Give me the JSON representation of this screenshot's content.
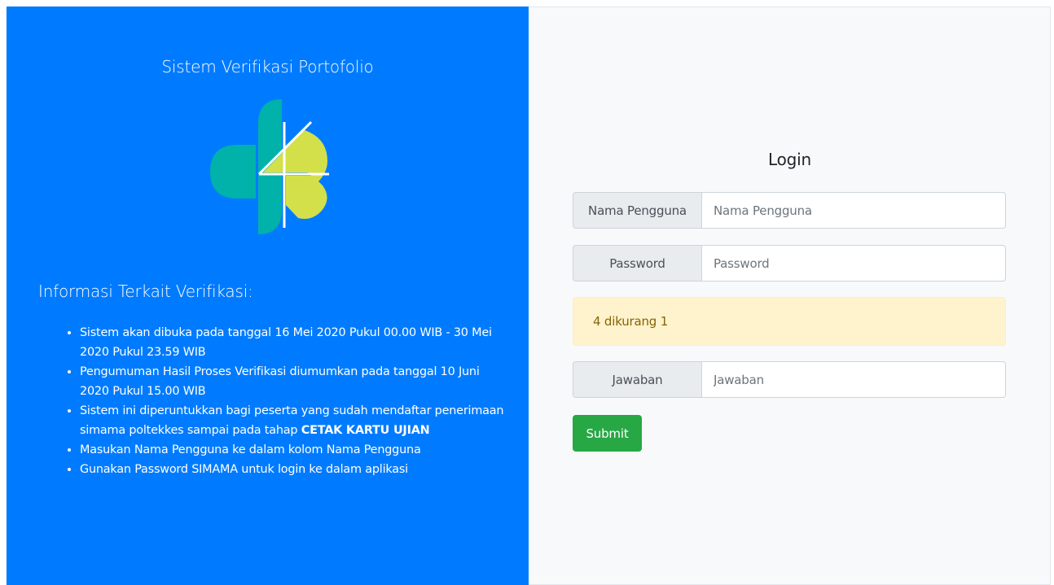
{
  "left": {
    "system_title": "Sistem Verifikasi Portofolio",
    "info_heading": "Informasi Terkait Verifikasi:",
    "info_items": [
      "Sistem akan dibuka pada tanggal 16 Mei 2020 Pukul 00.00 WIB - 30 Mei 2020 Pukul 23.59 WIB",
      "Pengumuman Hasil Proses Verifikasi diumumkan pada tanggal 10 Juni 2020 Pukul 15.00 WIB",
      "Sistem ini diperuntukkan bagi peserta yang sudah mendaftar penerimaan simama poltekkes sampai pada tahap ",
      "Masukan Nama Pengguna ke dalam kolom Nama Pengguna",
      "Gunakan Password SIMAMA untuk login ke dalam aplikasi"
    ],
    "info_item_bold": "CETAK KARTU UJIAN",
    "logo_colors": {
      "teal": "#00b2a9",
      "lime": "#d4e04a"
    }
  },
  "login": {
    "title": "Login",
    "username": {
      "label": "Nama Pengguna",
      "placeholder": "Nama Pengguna",
      "value": ""
    },
    "password": {
      "label": "Password",
      "placeholder": "Password",
      "value": ""
    },
    "captcha_question": "4 dikurang 1",
    "answer": {
      "label": "Jawaban",
      "placeholder": "Jawaban",
      "value": ""
    },
    "submit_label": "Submit"
  },
  "colors": {
    "primary": "#007bff",
    "success": "#28a745",
    "warning_bg": "#fff3cd",
    "warning_text": "#856404"
  }
}
